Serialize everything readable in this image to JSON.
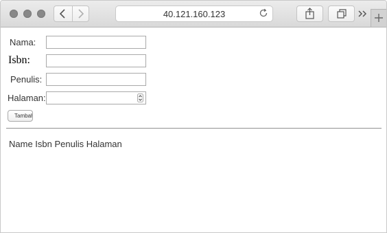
{
  "browser": {
    "url": "40.121.160.123",
    "icons": [
      "back-icon",
      "forward-icon",
      "reload-icon",
      "share-icon",
      "tabs-icon",
      "more-icon",
      "plus-icon"
    ]
  },
  "form": {
    "fields": [
      {
        "label": "Nama:",
        "value": ""
      },
      {
        "label": "Isbn:",
        "value": ""
      },
      {
        "label": "Penulis:",
        "value": ""
      },
      {
        "label": "Halaman:",
        "value": ""
      }
    ],
    "submit_label": "Tambahkan"
  },
  "table": {
    "headers": [
      "Name",
      "Isbn",
      "Penulis",
      "Halaman"
    ],
    "header_text": "Name Isbn Penulis Halaman"
  }
}
